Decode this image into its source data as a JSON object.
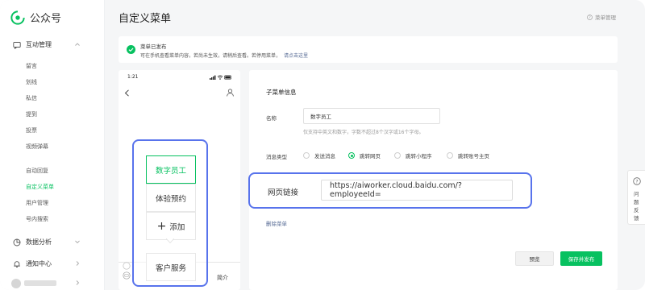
{
  "app": {
    "brand": "公众号",
    "title": "自定义菜单",
    "help": "菜单管理"
  },
  "sidebar": {
    "groups": [
      {
        "label": "互动管理"
      },
      {
        "label": "数据分析"
      },
      {
        "label": "通知中心"
      }
    ],
    "items": [
      {
        "label": "留言"
      },
      {
        "label": "划线"
      },
      {
        "label": "私信"
      },
      {
        "label": "提到"
      },
      {
        "label": "投票"
      },
      {
        "label": "视频弹幕"
      },
      {
        "label": "自动回复"
      },
      {
        "label": "自定义菜单",
        "active": true
      },
      {
        "label": "用户管理"
      },
      {
        "label": "号内搜索"
      }
    ]
  },
  "notice": {
    "title": "菜单已发布",
    "text": "可在手机查看菜单内容，若尚未生效，请稍后查看。若停用菜单，",
    "link": "请点击这里"
  },
  "phone": {
    "time": "1:21",
    "submenu": [
      {
        "label": "数字员工",
        "selected": true
      },
      {
        "label": "体验预约"
      }
    ],
    "add_label": "添加",
    "main_menu": "客户服务",
    "intro": "简介"
  },
  "form": {
    "section_title": "子菜单信息",
    "name_label": "名称",
    "name_value": "数字员工",
    "name_hint": "仅支持中英文和数字，字数不超过8个汉字或16个字母。",
    "type_label": "消息类型",
    "types": [
      {
        "label": "发送消息",
        "selected": false
      },
      {
        "label": "跳转网页",
        "selected": true
      },
      {
        "label": "跳转小程序",
        "selected": false
      },
      {
        "label": "跳转账号主页",
        "selected": false
      }
    ],
    "url_label": "网页链接",
    "url_value": "https://aiworker.cloud.baidu.com/?employeeId=",
    "delete_label": "删除菜单",
    "preview_label": "预览",
    "publish_label": "保存并发布"
  },
  "feedback": {
    "label": "问题反馈"
  },
  "colors": {
    "accent": "#07c160",
    "highlight": "#5873ec",
    "link": "#576b95"
  }
}
